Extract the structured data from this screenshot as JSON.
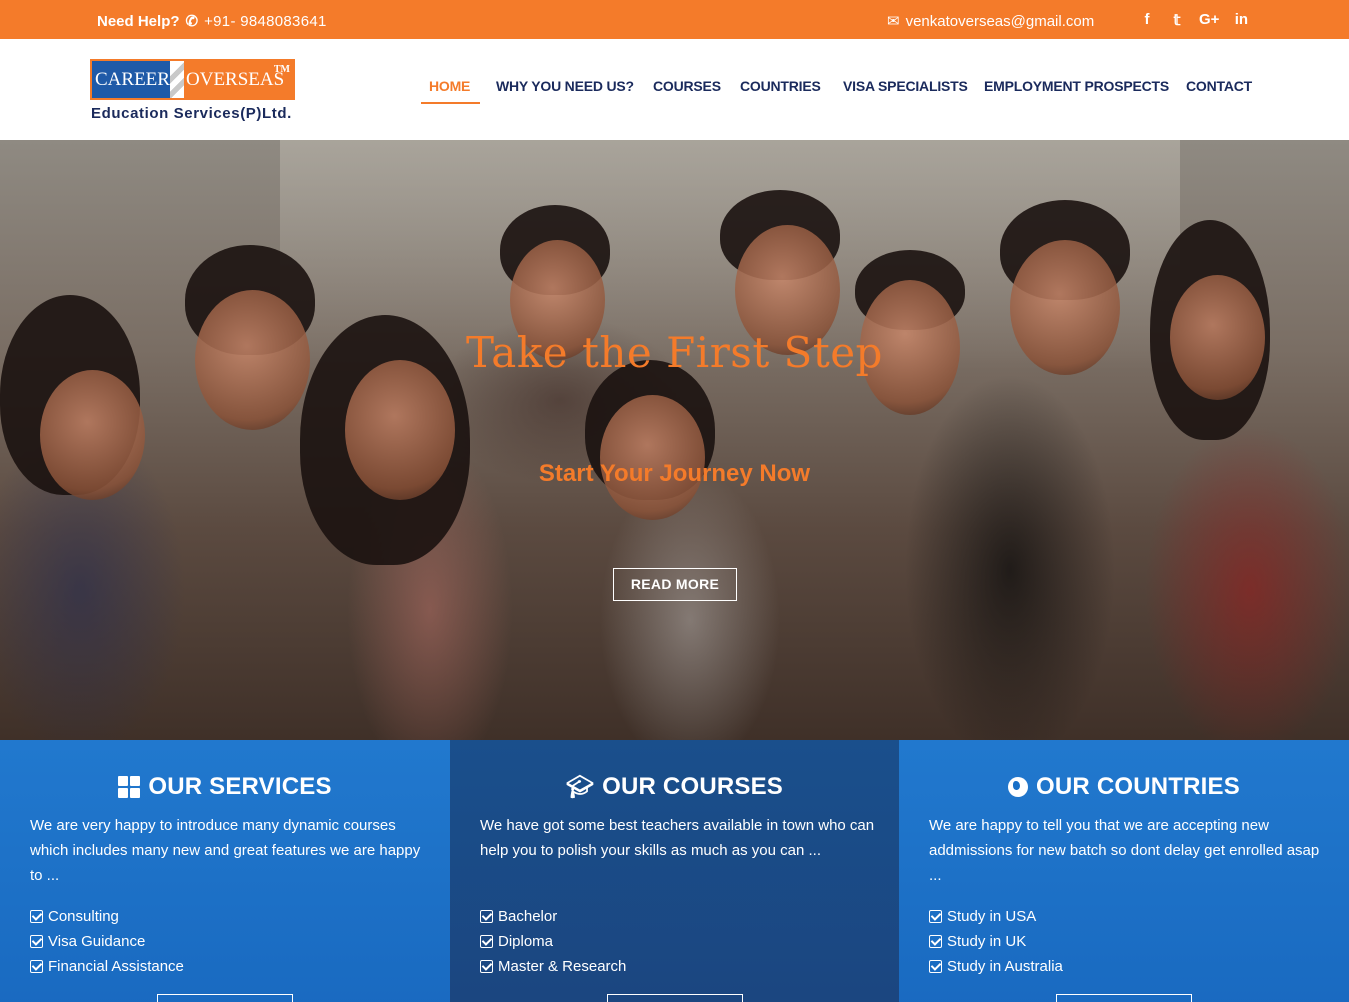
{
  "topbar": {
    "help_label": "Need Help?",
    "phone": "+91- 9848083641",
    "email": "venkatoverseas@gmail.com",
    "social_icons": [
      "facebook-icon",
      "twitter-icon",
      "google-plus-icon",
      "linkedin-icon"
    ],
    "social_glyphs": [
      "f",
      "𝕥",
      "G+",
      "in"
    ]
  },
  "logo": {
    "left_text": "CAREER",
    "right_text": "OVERSEAS",
    "tm": "TM",
    "subtitle": "Education Services(P)Ltd."
  },
  "nav": {
    "items": [
      {
        "label": "HOME",
        "active": true
      },
      {
        "label": "WHY YOU NEED US?",
        "active": false
      },
      {
        "label": "COURSES",
        "active": false
      },
      {
        "label": "COUNTRIES",
        "active": false
      },
      {
        "label": "VISA SPECIALISTS",
        "active": false
      },
      {
        "label": "EMPLOYMENT PROSPECTS",
        "active": false
      },
      {
        "label": "CONTACT",
        "active": false
      }
    ]
  },
  "hero": {
    "title": "Take the First Step",
    "subtitle": "Start Your Journey Now",
    "button_label": "READ MORE"
  },
  "panels": [
    {
      "icon": "grid-icon",
      "title": "OUR SERVICES",
      "text": "We are very happy to introduce many dynamic courses which includes many new and great features we are happy to ...",
      "items": [
        "Consulting",
        "Visa Guidance",
        "Financial Assistance"
      ]
    },
    {
      "icon": "graduation-cap-icon",
      "title": "OUR COURSES",
      "text": "We have got some best teachers available in town who can help you to polish your skills as much as you can ...",
      "items": [
        "Bachelor",
        "Diploma",
        "Master & Research"
      ]
    },
    {
      "icon": "globe-icon",
      "title": "OUR COUNTRIES",
      "text": "We are happy to tell you that we are accepting new addmissions for new batch so dont delay get enrolled asap ...",
      "items": [
        "Study in USA",
        "Study in UK",
        "Study in Australia"
      ]
    }
  ],
  "colors": {
    "accent": "#f47b2a",
    "navy": "#1a2a5c",
    "panel_blue": "#1870c8",
    "panel_dark": "#1a4f8c"
  }
}
